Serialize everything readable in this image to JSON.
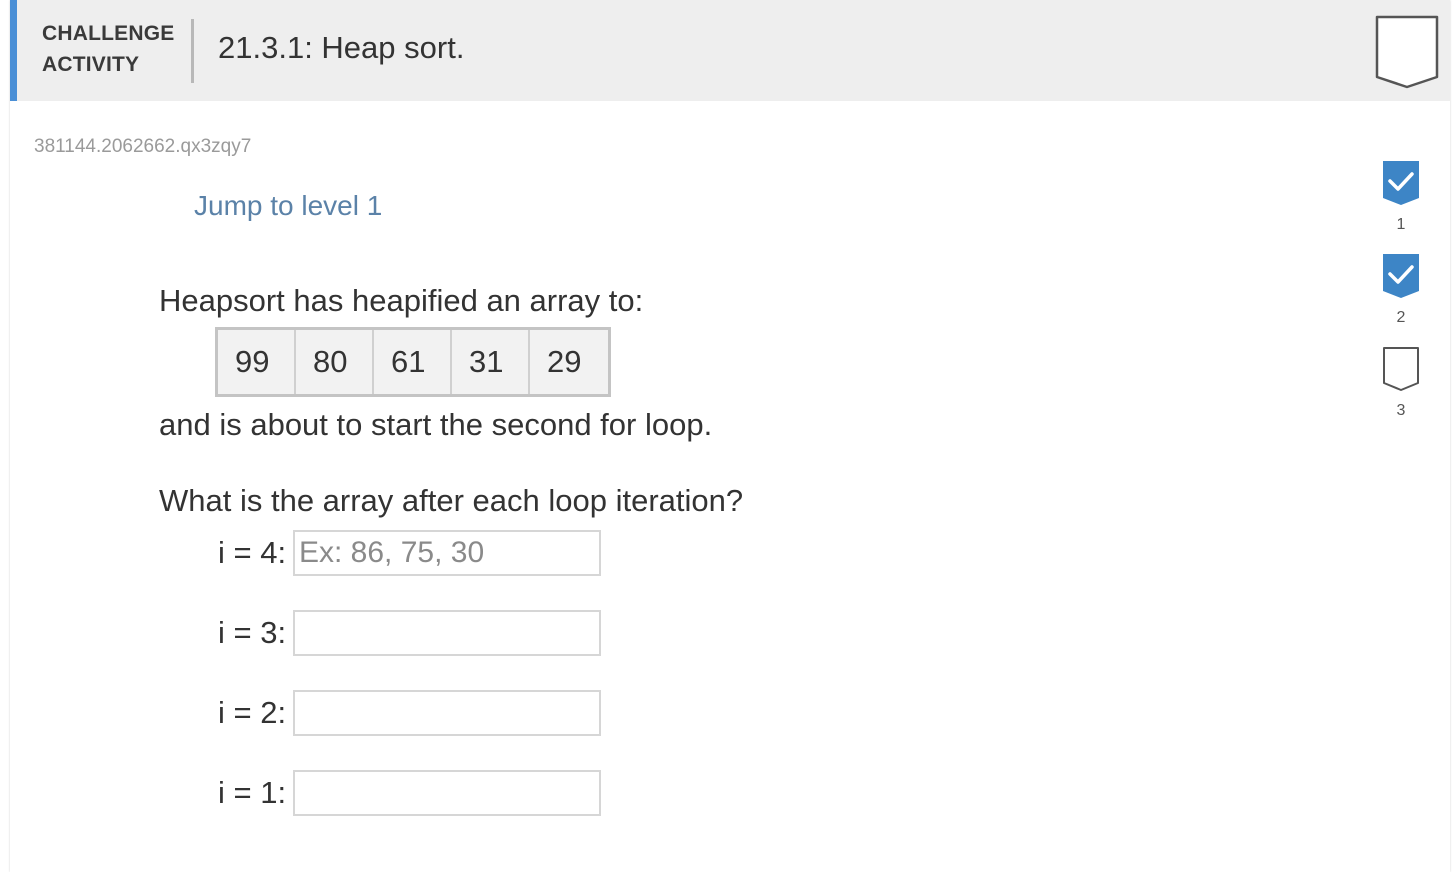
{
  "header": {
    "label_line1": "CHALLENGE",
    "label_line2": "ACTIVITY",
    "title": "21.3.1: Heap sort.",
    "badge_icon": "shield-outline-icon"
  },
  "activity_id": "381144.2062662.qx3zqy7",
  "jump_link": "Jump to level 1",
  "prompt": {
    "line1": "Heapsort has heapified an array to:",
    "line2": "and is about to start the second for loop.",
    "line3": "What is the array after each loop iteration?"
  },
  "array": [
    "99",
    "80",
    "61",
    "31",
    "29"
  ],
  "answers": [
    {
      "label": "i = 4:",
      "value": "",
      "placeholder": "Ex: 86, 75, 30"
    },
    {
      "label": "i = 3:",
      "value": "",
      "placeholder": ""
    },
    {
      "label": "i = 2:",
      "value": "",
      "placeholder": ""
    },
    {
      "label": "i = 1:",
      "value": "",
      "placeholder": ""
    }
  ],
  "levels": [
    {
      "number": "1",
      "completed": true
    },
    {
      "number": "2",
      "completed": true
    },
    {
      "number": "3",
      "completed": false
    }
  ],
  "colors": {
    "accent": "#4a8fd6",
    "level_complete": "#3d85c6",
    "link": "#5b82a8"
  }
}
